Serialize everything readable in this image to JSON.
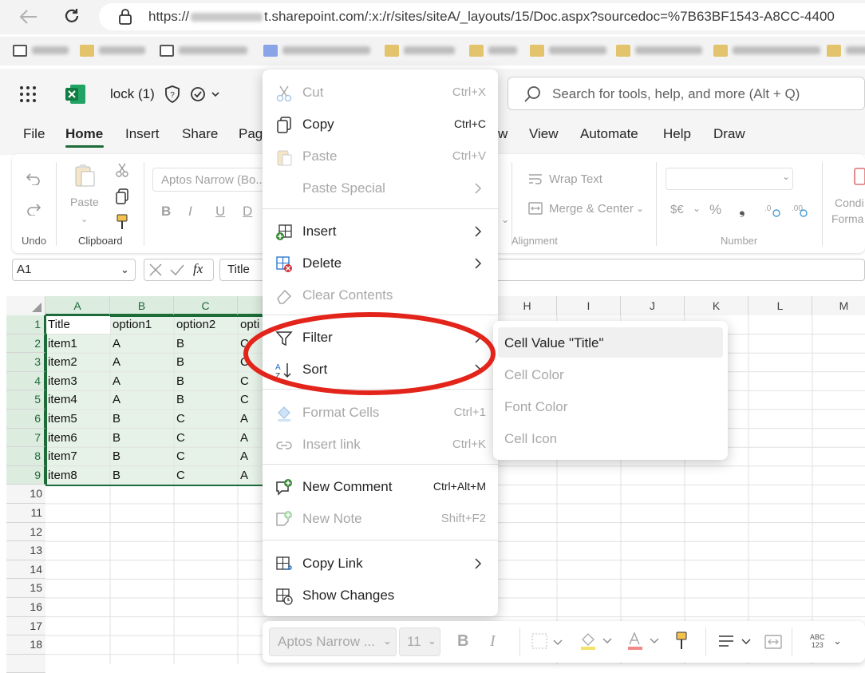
{
  "browser": {
    "url_prefix": "https://",
    "url_suffix": "t.sharepoint.com/:x:/r/sites/siteA/_layouts/15/Doc.aspx?sourcedoc=%7B63BF1543-A8CC-4400",
    "bookmarks": [
      "",
      "",
      "",
      "",
      "",
      "",
      "",
      "",
      "",
      ""
    ]
  },
  "app": {
    "file_title": "lock (1)",
    "search_placeholder": "Search for tools, help, and more (Alt + Q)",
    "tabs": [
      "File",
      "Home",
      "Insert",
      "Share",
      "Pag",
      "w",
      "View",
      "Automate",
      "Help",
      "Draw"
    ],
    "active_tab": "Home"
  },
  "ribbon": {
    "undo_label": "Undo",
    "paste_label": "Paste",
    "clipboard_label": "Clipboard",
    "font_name": "Aptos Narrow (Bo...",
    "font_b": "B",
    "font_i": "I",
    "font_u": "U",
    "font_d": "D",
    "wrap_text": "Wrap Text",
    "merge_center": "Merge & Center",
    "alignment_label": "Alignment",
    "number_label": "Number",
    "currency": "$€",
    "percent": "%",
    "comma": "❟",
    "cond_format_1": "Condi",
    "cond_format_2": "Forma"
  },
  "formula_bar": {
    "name_box": "A1",
    "fx": "fx",
    "value": "Title"
  },
  "grid": {
    "columns": [
      "A",
      "B",
      "C",
      "",
      "H",
      "I",
      "J",
      "K",
      "L",
      "M"
    ],
    "rows": [
      "1",
      "2",
      "3",
      "4",
      "5",
      "6",
      "7",
      "8",
      "9",
      "10",
      "11",
      "12",
      "13",
      "14",
      "15",
      "16",
      "17",
      "18"
    ],
    "data": [
      [
        "Title",
        "option1",
        "option2",
        "opti"
      ],
      [
        "item1",
        "A",
        "B",
        "C"
      ],
      [
        "item2",
        "A",
        "B",
        "C"
      ],
      [
        "item3",
        "A",
        "B",
        "C"
      ],
      [
        "item4",
        "A",
        "B",
        "C"
      ],
      [
        "item5",
        "B",
        "C",
        "A"
      ],
      [
        "item6",
        "B",
        "C",
        "A"
      ],
      [
        "item7",
        "B",
        "C",
        "A"
      ],
      [
        "item8",
        "B",
        "C",
        "A"
      ]
    ]
  },
  "context_menu": {
    "cut": "Cut",
    "cut_sc": "Ctrl+X",
    "copy": "Copy",
    "copy_sc": "Ctrl+C",
    "paste": "Paste",
    "paste_sc": "Ctrl+V",
    "paste_special": "Paste Special",
    "insert": "Insert",
    "delete": "Delete",
    "clear": "Clear Contents",
    "filter": "Filter",
    "sort": "Sort",
    "format_cells": "Format Cells",
    "format_sc": "Ctrl+1",
    "insert_link": "Insert link",
    "link_sc": "Ctrl+K",
    "new_comment": "New Comment",
    "comment_sc": "Ctrl+Alt+M",
    "new_note": "New Note",
    "note_sc": "Shift+F2",
    "copy_link": "Copy Link",
    "show_changes": "Show Changes"
  },
  "filter_submenu": {
    "cell_value": "Cell Value \"Title\"",
    "cell_color": "Cell Color",
    "font_color": "Font Color",
    "cell_icon": "Cell Icon"
  },
  "mini_toolbar": {
    "font": "Aptos Narrow ...",
    "size": "11",
    "bold": "B",
    "italic": "I",
    "abc": "ABC",
    "n123": "123"
  },
  "colors": {
    "excel_green": "#1e6b3a",
    "selection_fill": "#e6f2e8",
    "annotation_red": "#e3241b"
  }
}
